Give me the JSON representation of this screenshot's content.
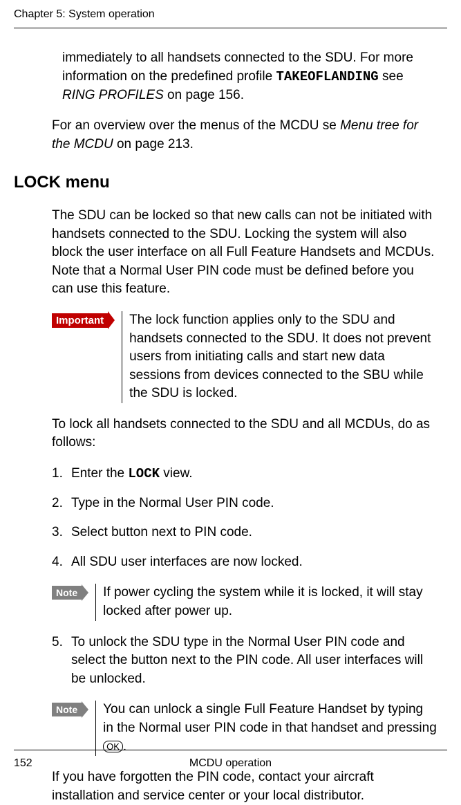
{
  "header": {
    "chapter": "Chapter 5:  System operation"
  },
  "first_para": {
    "text1": "immediately to all handsets connected to the SDU. For more information on the predefined profile ",
    "code": "TAKEOFLANDING",
    "text2": " see ",
    "ref": "RING PROFILES",
    "text3": " on page 156."
  },
  "overview": {
    "text1": "For an overview over the menus of the MCDU se ",
    "ref": "Menu tree for the MCDU",
    "text2": " on page 213."
  },
  "heading": "LOCK menu",
  "intro": "The SDU can be locked so that new calls can not be initiated with handsets connected to the SDU. Locking the system will also block the user interface on all Full Feature Handsets and MCDUs. Note that a Normal User PIN code must be defined before you can use this feature.",
  "important": {
    "label": "Important",
    "text": "The lock function applies only to the SDU and handsets connected to the SDU. It does not prevent users from initiating calls and start new data sessions from devices connected to the SBU while the SDU is locked."
  },
  "lockinstr": "To lock all handsets connected to the SDU and all MCDUs, do as follows:",
  "steps": {
    "s1a": "Enter the ",
    "s1b": "LOCK",
    "s1c": " view.",
    "s2": "Type in the Normal User PIN code.",
    "s3": "Select button next to PIN code.",
    "s4": "All SDU user interfaces are now locked.",
    "s5": "To unlock the SDU type in the Normal User PIN code and select the button next to the PIN code. All user interfaces will be unlocked."
  },
  "note1": {
    "label": "Note",
    "text": "If power cycling the system while it is locked, it will stay locked after power up."
  },
  "note2": {
    "label": "Note",
    "text": "You can unlock a single Full Feature Handset by typing in the Normal user PIN code in that handset and pressing ",
    "ok": "OK",
    "period": "."
  },
  "forgot": "If you have forgotten the PIN code, contact your aircraft installation and service center or your local distributor.",
  "footer": {
    "page": "152",
    "title": "MCDU operation"
  }
}
